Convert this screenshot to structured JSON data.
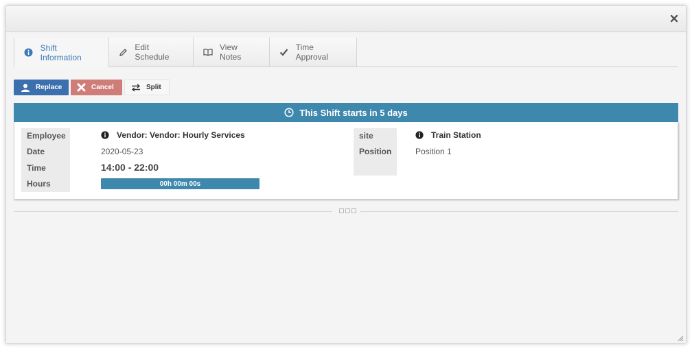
{
  "tabs": [
    {
      "label": "Shift Information",
      "icon": "info-icon",
      "active": true
    },
    {
      "label": "Edit Schedule",
      "icon": "pencil-icon",
      "active": false
    },
    {
      "label": "View Notes",
      "icon": "book-icon",
      "active": false
    },
    {
      "label": "Time Approval",
      "icon": "check-icon",
      "active": false
    }
  ],
  "actions": {
    "replace_label": "Replace",
    "cancel_label": "Cancel",
    "split_label": "Split"
  },
  "banner": {
    "text": "This Shift starts in 5 days"
  },
  "details": {
    "employee_label": "Employee",
    "employee_value": "Vendor: Vendor: Hourly Services",
    "date_label": "Date",
    "date_value": "2020-05-23",
    "time_label": "Time",
    "time_value": "14:00 - 22:00",
    "hours_label": "Hours",
    "hours_value": "00h 00m 00s",
    "site_label": "site",
    "site_value": "Train Station",
    "position_label": "Position",
    "position_value": "Position 1"
  },
  "colors": {
    "primary": "#3b6fae",
    "banner": "#3e88ae",
    "danger": "#cf7d79",
    "active_tab_text": "#3a7ab8"
  }
}
